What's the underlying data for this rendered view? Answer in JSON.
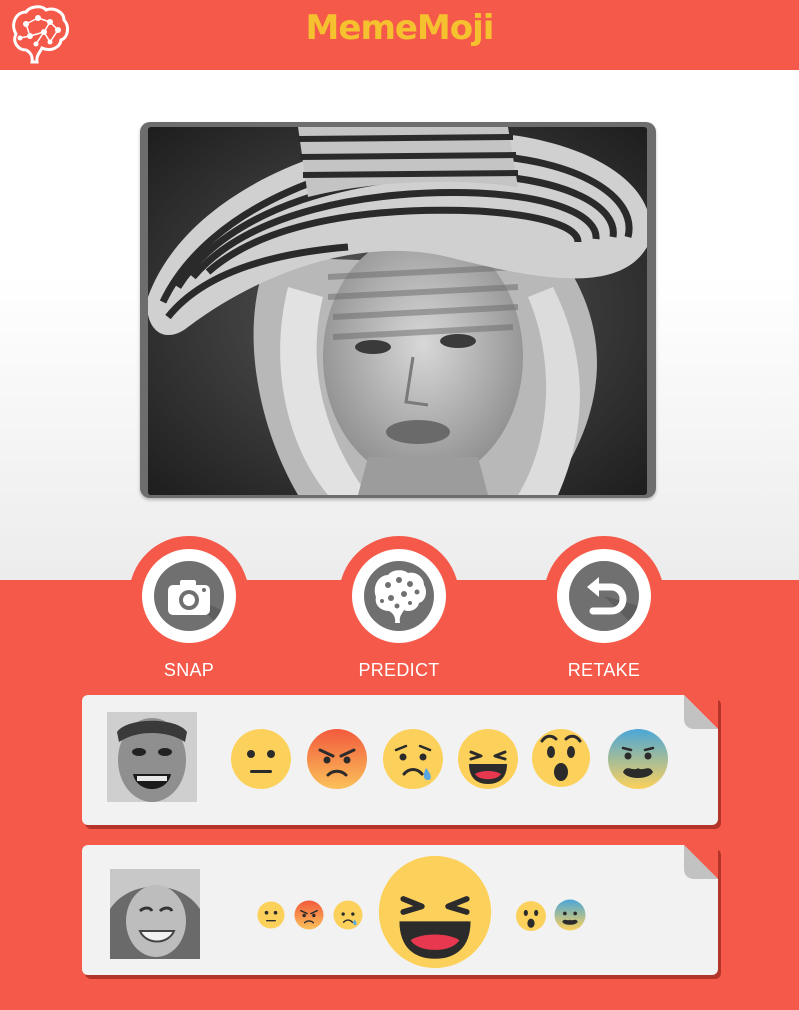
{
  "app": {
    "title": "MemeMoji",
    "header_color": "#f5594a",
    "title_color": "#f5c12e"
  },
  "photo": {
    "icon": "portrait-photo",
    "description_type": "grayscale-photo"
  },
  "actions": [
    {
      "label": "SNAP",
      "icon": "camera-icon"
    },
    {
      "label": "PREDICT",
      "icon": "brain-icon"
    },
    {
      "label": "RETAKE",
      "icon": "undo-icon"
    }
  ],
  "results": [
    {
      "thumb_icon": "screaming-face",
      "emotions": [
        "neutral",
        "angry",
        "sad",
        "happy",
        "surprised",
        "fear"
      ],
      "highlighted": null
    },
    {
      "thumb_icon": "smiling-face",
      "emotions": [
        "neutral",
        "angry",
        "sad",
        "happy",
        "surprised",
        "fear"
      ],
      "highlighted": "happy"
    }
  ]
}
